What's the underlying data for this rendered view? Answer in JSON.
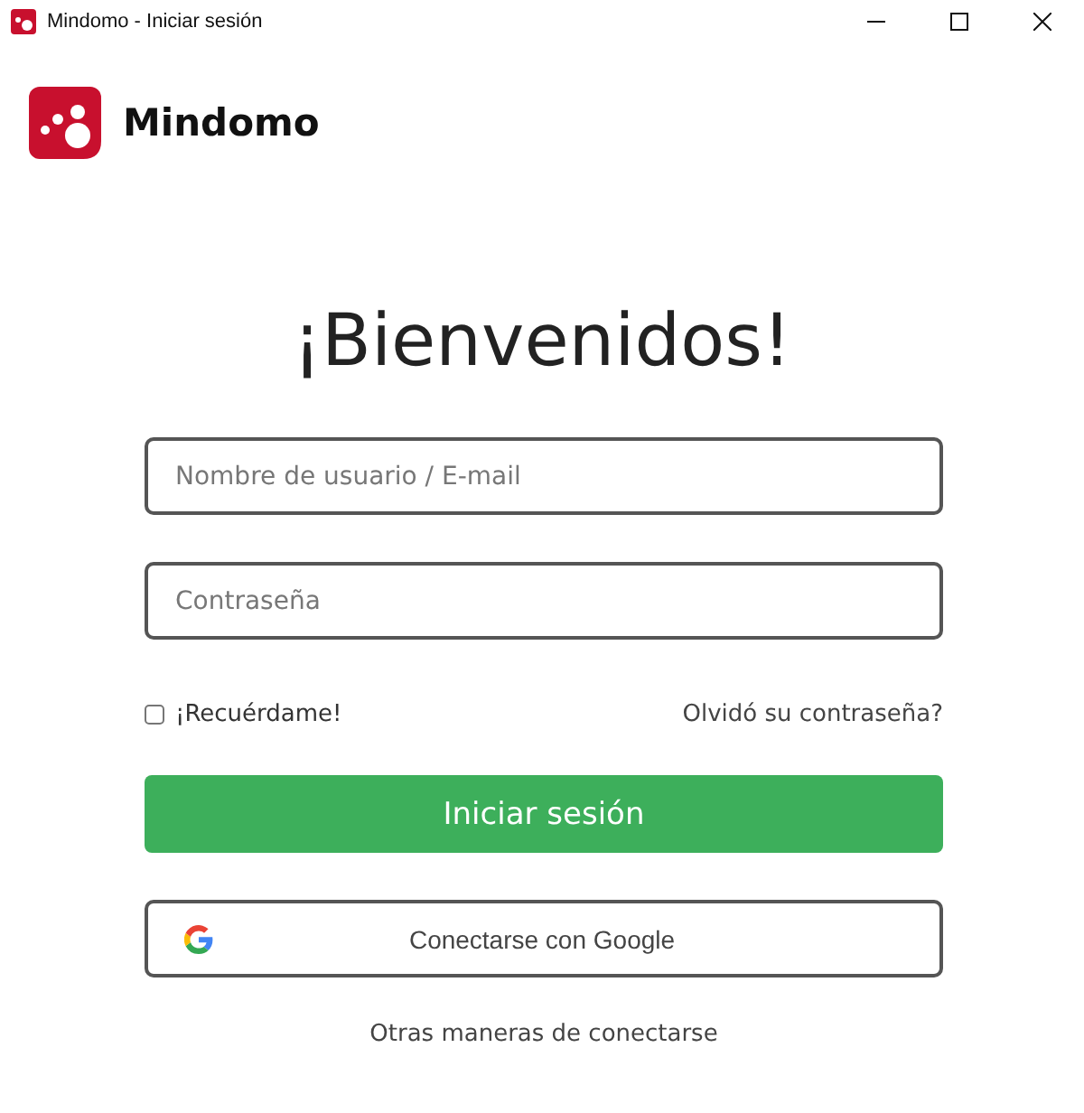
{
  "window": {
    "title": "Mindomo - Iniciar sesión"
  },
  "brand": {
    "name": "Mindomo"
  },
  "heading": "¡Bienvenidos!",
  "fields": [
    {
      "placeholder": "Nombre de usuario / E-mail"
    },
    {
      "placeholder": "Contraseña"
    }
  ],
  "remember": {
    "label": "¡Recuérdame!",
    "checked": false
  },
  "forgot_link": "Olvidó su contraseña?",
  "login_button": "Iniciar sesión",
  "google_button": "Conectarse con Google",
  "other_link": "Otras maneras de conectarse"
}
